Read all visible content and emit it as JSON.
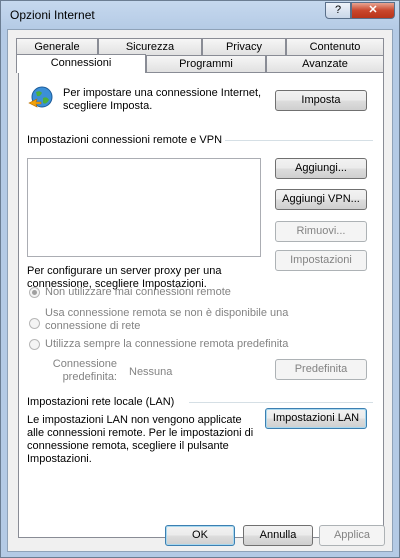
{
  "window": {
    "title": "Opzioni Internet",
    "help_glyph": "?",
    "close_glyph": "✕"
  },
  "tabs": {
    "row1": [
      "Generale",
      "Sicurezza",
      "Privacy",
      "Contenuto"
    ],
    "row2": [
      "Connessioni",
      "Programmi",
      "Avanzate"
    ],
    "active": "Connessioni"
  },
  "setup": {
    "text": "Per impostare una connessione Internet, scegliere Imposta.",
    "button": "Imposta"
  },
  "vpn": {
    "header": "Impostazioni connessioni remote e VPN",
    "add_button": "Aggiungi...",
    "add_vpn_button": "Aggiungi VPN...",
    "remove_button": "Rimuovi...",
    "settings_button": "Impostazioni",
    "proxy_text": "Per configurare un server proxy per una connessione, scegliere Impostazioni."
  },
  "dialup": {
    "options": [
      "Non utilizzare mai connessioni remote",
      "Usa connessione remota se non è disponibile una connessione di rete",
      "Utilizza sempre la connessione remota predefinita"
    ],
    "selected_index": 0,
    "default_label": "Connessione predefinita:",
    "default_value": "Nessuna",
    "default_button": "Predefinita"
  },
  "lan": {
    "header": "Impostazioni rete locale (LAN)",
    "text": "Le impostazioni LAN non vengono applicate alle connessioni remote. Per le impostazioni di connessione remota, scegliere il pulsante Impostazioni.",
    "button": "Impostazioni LAN"
  },
  "footer": {
    "ok": "OK",
    "cancel": "Annulla",
    "apply": "Applica"
  }
}
